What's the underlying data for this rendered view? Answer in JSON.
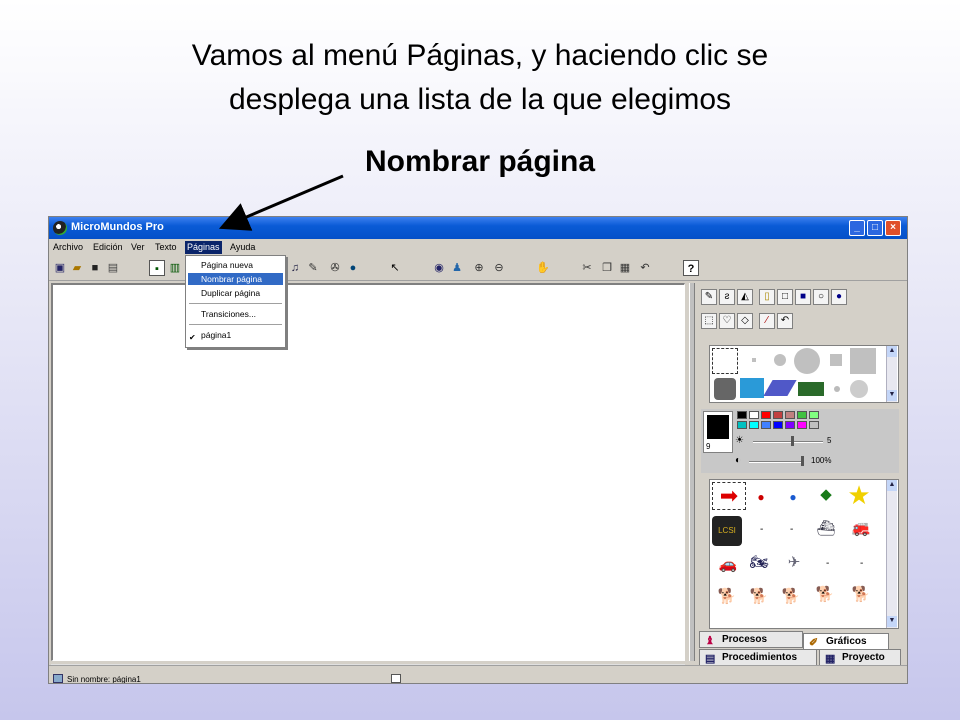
{
  "slide": {
    "line1": "Vamos al menú Páginas, y haciendo clic se",
    "line2": "desplega una lista de la que elegimos",
    "highlight": "Nombrar página"
  },
  "window": {
    "title": "MicroMundos Pro",
    "controls": [
      "minimize-icon",
      "maximize-icon",
      "close-icon"
    ]
  },
  "menubar": {
    "items": [
      "Archivo",
      "Edición",
      "Ver",
      "Texto",
      "Páginas",
      "Ayuda"
    ],
    "active": "Páginas"
  },
  "toolbar": {
    "icons": [
      "new-page-icon",
      "open-icon",
      "save-icon",
      "print-icon",
      "page-view-icon",
      "page-list-icon",
      "music-icon",
      "tools-icon",
      "video-icon",
      "globe-icon",
      "pointer-icon",
      "eye-icon",
      "stamp-icon",
      "zoom-in-icon",
      "zoom-out-icon",
      "stop-icon",
      "cut-icon",
      "copy-icon",
      "paste-icon",
      "undo-icon",
      "help-icon"
    ],
    "help_label": "?"
  },
  "pages_menu": {
    "items": [
      "Página nueva",
      "Nombrar página",
      "Duplicar página",
      "Transiciones...",
      "página1"
    ],
    "highlighted": "Nombrar página",
    "checked": "página1"
  },
  "paint_panel": {
    "tools_row1": [
      "pencil-icon",
      "brush-icon",
      "fill-bucket-icon",
      "spray-icon",
      "rectangle-icon",
      "filled-rectangle-icon",
      "circle-icon",
      "filled-circle-icon"
    ],
    "tools_row2": [
      "select-icon",
      "lasso-icon",
      "eraser-icon",
      "eyedropper-icon",
      "undo-icon"
    ],
    "pen_size": "9",
    "brightness_value": "5",
    "opacity_value": "100%",
    "palette": [
      "#000000",
      "#ffffff",
      "#ff0000",
      "#c04040",
      "#c08080",
      "#40c040",
      "#80ff80",
      "#00c0c0",
      "#00ffff",
      "#4080ff",
      "#0000ff",
      "#8000ff",
      "#ff00ff",
      "#c0c0c0"
    ]
  },
  "shapes_panel": {
    "items": [
      "red-arrow",
      "red-ball",
      "blue-ball",
      "green-diamond",
      "yellow-star",
      "lcsi-badge",
      "dash",
      "dash",
      "boat",
      "firetruck",
      "red-car",
      "motorbike",
      "airplane",
      "dash",
      "dash",
      "dog",
      "dog",
      "dog",
      "dalmatian",
      "dalmatian"
    ]
  },
  "tabs": {
    "processes": "Procesos",
    "graphics": "Gráficos",
    "procedures": "Procedimientos",
    "project": "Proyecto"
  },
  "status": {
    "text": "Sin nombre: página1"
  }
}
